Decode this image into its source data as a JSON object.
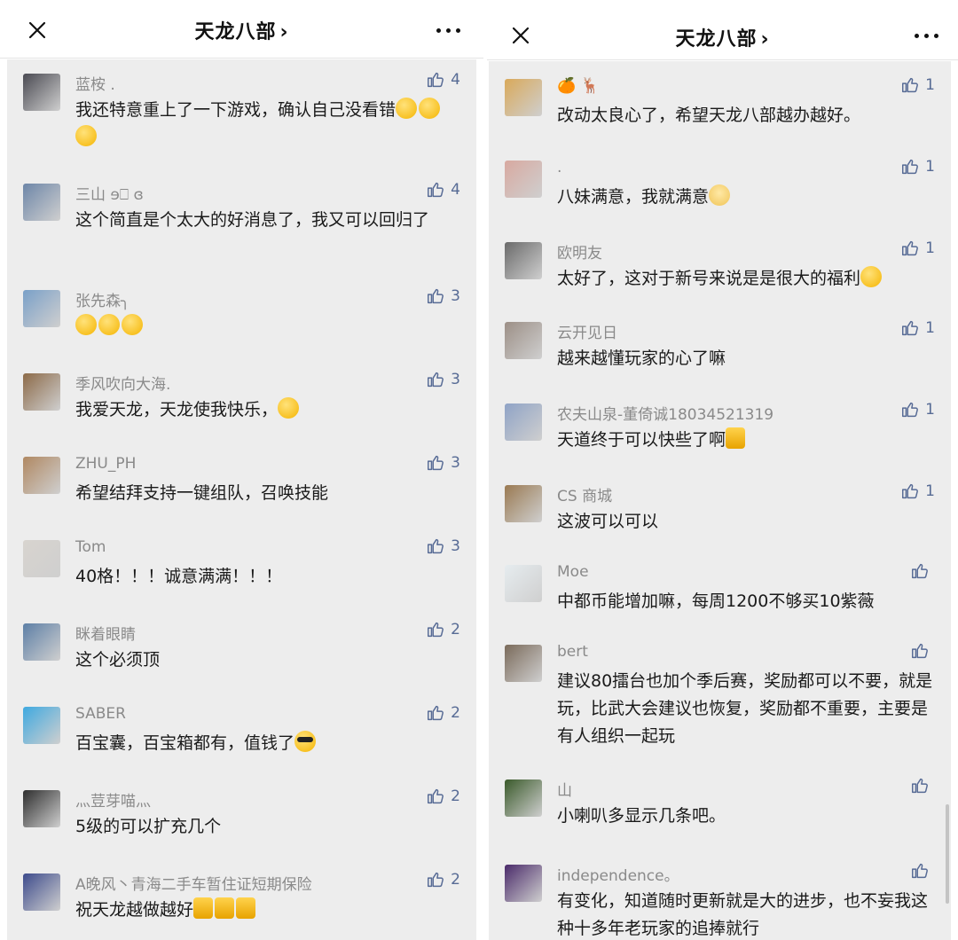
{
  "left": {
    "title": "天龙八部",
    "comments": [
      {
        "nick": "蓝桉 .",
        "text": "我还特意重上了一下游戏，确认自己没看错",
        "likes": "4",
        "emoji": "laugh x3",
        "avatar_color": "#4a4a52"
      },
      {
        "nick": "三山 ɘ⎕ ɞ",
        "text": "这个简直是个太大的好消息了，我又可以回归了",
        "likes": "4",
        "avatar_color": "#6d86a8"
      },
      {
        "nick": "张先森╮",
        "text": "",
        "likes": "3",
        "emoji": "clap x3",
        "avatar_color": "#7aa0c8"
      },
      {
        "nick": "季风吹向大海.",
        "text": "我爱天龙，天龙使我快乐，",
        "likes": "3",
        "emoji": "666",
        "avatar_color": "#8c6a48"
      },
      {
        "nick": "ZHU_PH",
        "text": "希望结拜支持一键组队，召唤技能",
        "likes": "3",
        "avatar_color": "#b08862"
      },
      {
        "nick": "Tom",
        "text": "40格！！！诚意满满！！！",
        "likes": "3",
        "avatar_color": "#d8d4cf"
      },
      {
        "nick": "眯着眼睛",
        "text": "这个必须顶",
        "likes": "2",
        "avatar_color": "#5d7fa6"
      },
      {
        "nick": "SABER",
        "text": "百宝囊，百宝箱都有，值钱了",
        "likes": "2",
        "emoji": "cool",
        "avatar_color": "#3fa9e0"
      },
      {
        "nick": "灬荳芽喵灬",
        "text": "5级的可以扩充几个",
        "likes": "2",
        "avatar_color": "#2e2e2e"
      },
      {
        "nick": "A晚风丶青海二手车暂住证短期保险",
        "text": "祝天龙越做越好",
        "likes": "2",
        "emoji": "thumbs x3",
        "avatar_color": "#3d4b8c"
      }
    ]
  },
  "right": {
    "title": "天龙八部",
    "comments": [
      {
        "nick": "🍊 🦌",
        "text": "改动太良心了，希望天龙八部越办越好。",
        "likes": "1",
        "avatar_color": "#d9a95a"
      },
      {
        "nick": ".",
        "text": "八妹满意，我就满意",
        "likes": "1",
        "emoji": "cat",
        "avatar_color": "#d8a9a0"
      },
      {
        "nick": "欧明友",
        "text": "太好了，这对于新号来说是是很大的福利",
        "likes": "1",
        "emoji": "grin",
        "avatar_color": "#6a6a6a"
      },
      {
        "nick": "云开见日",
        "text": "越来越懂玩家的心了嘛",
        "likes": "1",
        "avatar_color": "#9c8f86"
      },
      {
        "nick": "农夫山泉-董倚诚18034521319",
        "text": "天道终于可以快些了啊",
        "likes": "1",
        "emoji": "thumb",
        "avatar_color": "#8fa3c6"
      },
      {
        "nick": "CS 商城",
        "text": "这波可以可以",
        "likes": "1",
        "avatar_color": "#9a7a52"
      },
      {
        "nick": "Moe",
        "text": "中都币能增加嘛，每周1200不够买10紫薇",
        "likes": "",
        "avatar_color": "#e6ecef"
      },
      {
        "nick": "bert",
        "text": "建议80擂台也加个季后赛，奖励都可以不要，就是玩，比武大会建议也恢复，奖励都不重要，主要是有人组织一起玩",
        "likes": "",
        "avatar_color": "#7a6a5a"
      },
      {
        "nick": "山",
        "text": "小喇叭多显示几条吧。",
        "likes": "",
        "avatar_color": "#3a5a2a"
      },
      {
        "nick": "independence。",
        "text": "有变化，知道随时更新就是大的进步，也不妄我这种十多年老玩家的追捧就行",
        "likes": "",
        "avatar_color": "#4a2a6a"
      }
    ]
  }
}
